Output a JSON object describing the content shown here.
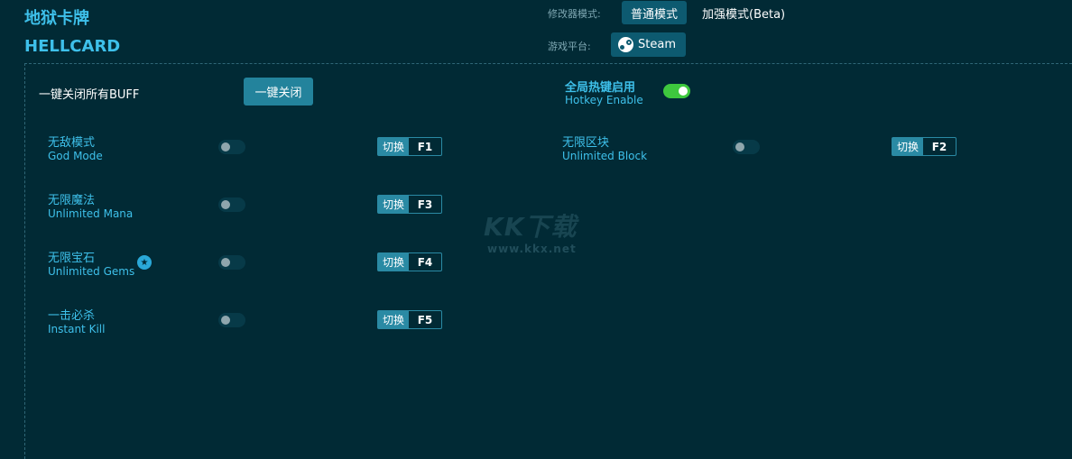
{
  "header": {
    "title_cn": "地狱卡牌",
    "title_en": "HELLCARD",
    "mode_label": "修改器模式:",
    "mode_normal": "普通模式",
    "mode_enhanced": "加强模式(Beta)",
    "platform_label": "游戏平台:",
    "platform_steam": "Steam"
  },
  "controls": {
    "close_all_label": "一键关闭所有BUFF",
    "close_all_button": "一键关闭",
    "hotkey_enable_cn": "全局热键启用",
    "hotkey_enable_en": "Hotkey Enable",
    "hotkey_enabled": true
  },
  "switch_label": "切换",
  "cheats": [
    {
      "cn": "无敌模式",
      "en": "God Mode",
      "key": "F1",
      "enabled": false
    },
    {
      "cn": "无限区块",
      "en": "Unlimited Block",
      "key": "F2",
      "enabled": false
    },
    {
      "cn": "无限魔法",
      "en": "Unlimited Mana",
      "key": "F3",
      "enabled": false
    },
    {
      "cn": "无限宝石",
      "en": "Unlimited Gems",
      "key": "F4",
      "enabled": false,
      "starred": true
    },
    {
      "cn": "一击必杀",
      "en": "Instant Kill",
      "key": "F5",
      "enabled": false
    }
  ],
  "watermark": {
    "logo": "KK下载",
    "url": "www.kkx.net"
  },
  "colors": {
    "background": "#012a35",
    "accent": "#3ec0ea",
    "button": "#0d5a70",
    "toggle_on": "#3ec83e"
  },
  "icons": {
    "steam": "steam-icon",
    "star": "star-badge-icon"
  }
}
